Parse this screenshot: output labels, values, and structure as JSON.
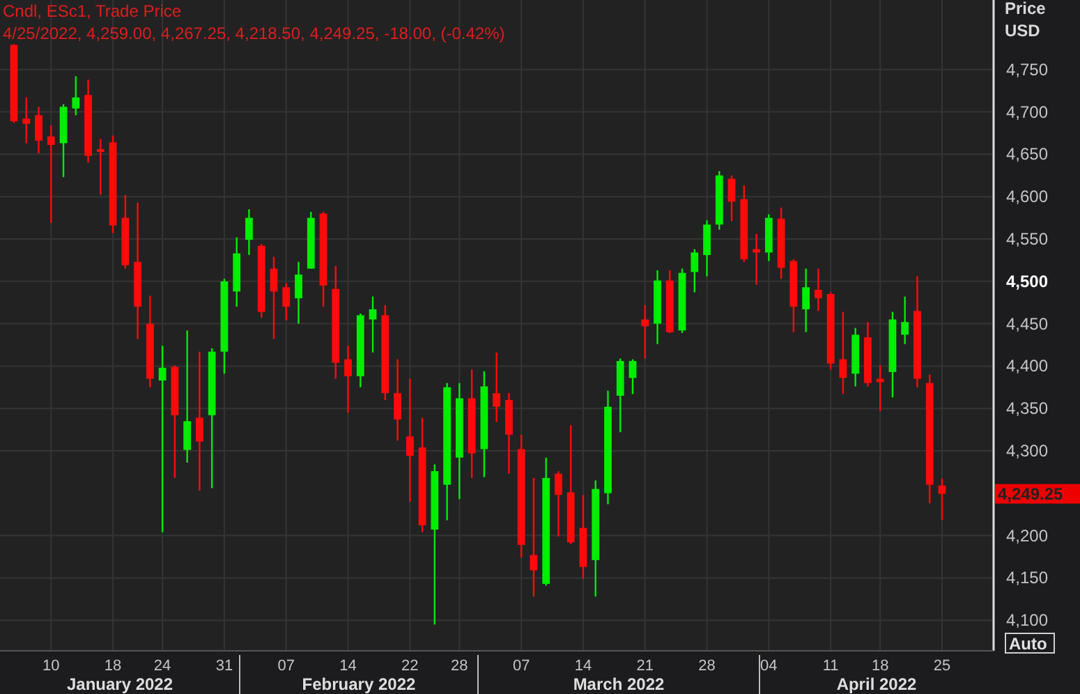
{
  "header": {
    "title": "Cndl, ESc1, Trade Price",
    "quote": "4/25/2022, 4,259.00, 4,267.25, 4,218.50, 4,249.25, -18.00, (-0.42%)"
  },
  "chart_data": {
    "type": "candlestick",
    "grid": true,
    "ylim": [
      4064,
      4832
    ],
    "yticks": [
      {
        "value": 4750,
        "label": "4,750"
      },
      {
        "value": 4700,
        "label": "4,700"
      },
      {
        "value": 4650,
        "label": "4,650"
      },
      {
        "value": 4600,
        "label": "4,600"
      },
      {
        "value": 4550,
        "label": "4,550"
      },
      {
        "value": 4500,
        "label": "4,500"
      },
      {
        "value": 4450,
        "label": "4,450"
      },
      {
        "value": 4400,
        "label": "4,400"
      },
      {
        "value": 4350,
        "label": "4,350"
      },
      {
        "value": 4300,
        "label": "4,300"
      },
      {
        "value": 4200,
        "label": "4,200"
      },
      {
        "value": 4150,
        "label": "4,150"
      },
      {
        "value": 4100,
        "label": "4,100"
      }
    ],
    "categories": [
      null,
      null,
      null,
      "10",
      null,
      null,
      null,
      null,
      "18",
      null,
      null,
      null,
      "24",
      null,
      null,
      null,
      null,
      "31",
      null,
      null,
      null,
      null,
      "07",
      null,
      null,
      null,
      null,
      "14",
      null,
      null,
      null,
      null,
      "22",
      null,
      null,
      null,
      "28",
      null,
      null,
      null,
      null,
      "07",
      null,
      null,
      null,
      null,
      "14",
      null,
      null,
      null,
      null,
      "21",
      null,
      null,
      null,
      null,
      "28",
      null,
      null,
      null,
      null,
      "04",
      null,
      null,
      null,
      null,
      "11",
      null,
      null,
      null,
      "18",
      null,
      null,
      null,
      null,
      "25"
    ],
    "ohlc": [
      [
        4779,
        4780,
        4687,
        4689
      ],
      [
        4692,
        4717,
        4663,
        4686
      ],
      [
        4696,
        4706,
        4651,
        4666
      ],
      [
        4671,
        4684,
        4569,
        4661
      ],
      [
        4663,
        4709,
        4623,
        4706
      ],
      [
        4704,
        4742,
        4696,
        4717
      ],
      [
        4720,
        4738,
        4640,
        4648
      ],
      [
        4656,
        4668,
        4602,
        4654
      ],
      [
        4664,
        4672,
        4557,
        4566
      ],
      [
        4575,
        4602,
        4515,
        4519
      ],
      [
        4523,
        4593,
        4432,
        4470
      ],
      [
        4450,
        4483,
        4375,
        4385
      ],
      [
        4383,
        4424,
        4204,
        4398
      ],
      [
        4399,
        4401,
        4268,
        4342
      ],
      [
        4301,
        4442,
        4286,
        4335
      ],
      [
        4339,
        4417,
        4253,
        4311
      ],
      [
        4342,
        4421,
        4256,
        4417
      ],
      [
        4417,
        4503,
        4391,
        4500
      ],
      [
        4488,
        4552,
        4470,
        4533
      ],
      [
        4549,
        4585,
        4531,
        4575
      ],
      [
        4542,
        4544,
        4457,
        4464
      ],
      [
        4515,
        4529,
        4432,
        4488
      ],
      [
        4493,
        4498,
        4454,
        4470
      ],
      [
        4480,
        4523,
        4450,
        4508
      ],
      [
        4515,
        4582,
        4515,
        4575
      ],
      [
        4580,
        4582,
        4470,
        4495
      ],
      [
        4491,
        4518,
        4385,
        4404
      ],
      [
        4408,
        4424,
        4345,
        4388
      ],
      [
        4388,
        4462,
        4375,
        4460
      ],
      [
        4455,
        4482,
        4416,
        4467
      ],
      [
        4460,
        4472,
        4360,
        4368
      ],
      [
        4368,
        4408,
        4312,
        4337
      ],
      [
        4317,
        4385,
        4240,
        4294
      ],
      [
        4304,
        4339,
        4204,
        4212
      ],
      [
        4207,
        4284,
        4095,
        4276
      ],
      [
        4260,
        4380,
        4218,
        4375
      ],
      [
        4292,
        4380,
        4243,
        4362
      ],
      [
        4362,
        4396,
        4268,
        4297
      ],
      [
        4302,
        4394,
        4269,
        4376
      ],
      [
        4368,
        4416,
        4334,
        4352
      ],
      [
        4360,
        4368,
        4273,
        4319
      ],
      [
        4302,
        4319,
        4174,
        4189
      ],
      [
        4177,
        4268,
        4128,
        4159
      ],
      [
        4143,
        4292,
        4141,
        4268
      ],
      [
        4273,
        4276,
        4199,
        4248
      ],
      [
        4251,
        4330,
        4190,
        4192
      ],
      [
        4209,
        4248,
        4149,
        4163
      ],
      [
        4171,
        4265,
        4128,
        4255
      ],
      [
        4250,
        4371,
        4237,
        4352
      ],
      [
        4365,
        4409,
        4322,
        4406
      ],
      [
        4386,
        4408,
        4367,
        4406
      ],
      [
        4455,
        4472,
        4409,
        4447
      ],
      [
        4450,
        4513,
        4426,
        4501
      ],
      [
        4501,
        4513,
        4439,
        4440
      ],
      [
        4442,
        4515,
        4439,
        4510
      ],
      [
        4511,
        4538,
        4487,
        4534
      ],
      [
        4531,
        4572,
        4506,
        4567
      ],
      [
        4567,
        4630,
        4561,
        4625
      ],
      [
        4621,
        4625,
        4571,
        4594
      ],
      [
        4597,
        4613,
        4523,
        4526
      ],
      [
        4538,
        4556,
        4496,
        4534
      ],
      [
        4534,
        4579,
        4524,
        4575
      ],
      [
        4574,
        4587,
        4503,
        4516
      ],
      [
        4524,
        4526,
        4440,
        4470
      ],
      [
        4467,
        4515,
        4440,
        4493
      ],
      [
        4490,
        4515,
        4465,
        4480
      ],
      [
        4485,
        4487,
        4396,
        4403
      ],
      [
        4408,
        4464,
        4367,
        4386
      ],
      [
        4391,
        4445,
        4376,
        4437
      ],
      [
        4434,
        4452,
        4376,
        4380
      ],
      [
        4385,
        4401,
        4347,
        4381
      ],
      [
        4393,
        4464,
        4363,
        4455
      ],
      [
        4437,
        4482,
        4426,
        4452
      ],
      [
        4465,
        4506,
        4375,
        4385
      ],
      [
        4380,
        4390,
        4238,
        4260
      ],
      [
        4259,
        4267.25,
        4218.5,
        4249.25
      ]
    ]
  },
  "price_axis": {
    "title": [
      "Price",
      "USD"
    ],
    "ticks": [
      {
        "bold": false
      },
      {
        "bold": false
      },
      {
        "bold": false
      },
      {
        "bold": false
      },
      {
        "bold": false
      },
      {
        "bold": true
      },
      {
        "bold": false
      },
      {
        "bold": false
      },
      {
        "bold": false
      },
      {
        "bold": false
      },
      {
        "bold": false
      },
      {
        "bold": false
      },
      {
        "bold": false
      }
    ],
    "last_price": "4,249.25",
    "auto_button": "Auto"
  },
  "months": [
    "January 2022",
    "February 2022",
    "March 2022",
    "April 2022"
  ]
}
